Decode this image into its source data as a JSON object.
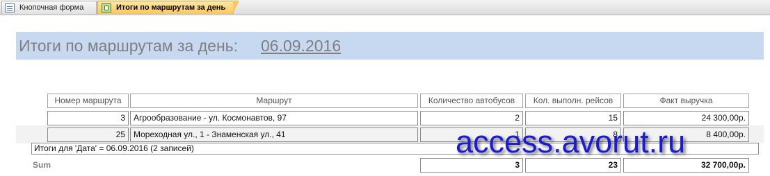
{
  "tabs": [
    {
      "label": "Кнопочная форма",
      "icon": "form-icon"
    },
    {
      "label": "Итоги по маршрутам за день",
      "icon": "report-icon",
      "active": true
    }
  ],
  "report": {
    "title": "Итоги по маршрутам за день:",
    "date": "06.09.2016"
  },
  "table": {
    "columns": [
      "Номер маршрута",
      "Маршрут",
      "Количество автобусов",
      "Кол. выполн. рейсов",
      "Факт выручка"
    ],
    "rows": [
      {
        "number": "3",
        "route": "Агрообразование - ул. Космонавтов, 97",
        "buses": "2",
        "trips": "15",
        "revenue": "24 300,00р."
      },
      {
        "number": "25",
        "route": "Мореходная ул., 1 - Знаменская ул., 41",
        "buses": "1",
        "trips": "8",
        "revenue": "8 400,00р."
      }
    ]
  },
  "group_footer": "Итоги для 'Дата' =  06.09.2016 (2 записей)",
  "sum": {
    "label": "Sum",
    "buses": "3",
    "trips": "23",
    "revenue": "32 700,00р."
  },
  "watermark": "access.avorut.ru",
  "colors": {
    "header_band": "#c6d9f1",
    "active_tab": "#fbc75a",
    "watermark": "#1b1bd6"
  }
}
